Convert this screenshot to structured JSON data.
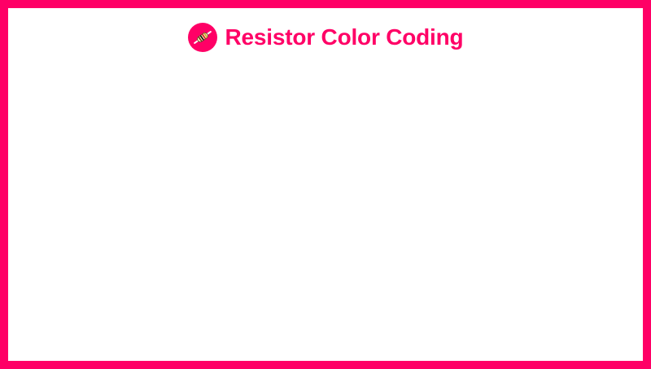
{
  "app": {
    "title": "Resistor Color Coding",
    "logo_icon": "resistor-icon"
  },
  "colors": {
    "accent": "#ff0066",
    "background": "#ffffff"
  }
}
